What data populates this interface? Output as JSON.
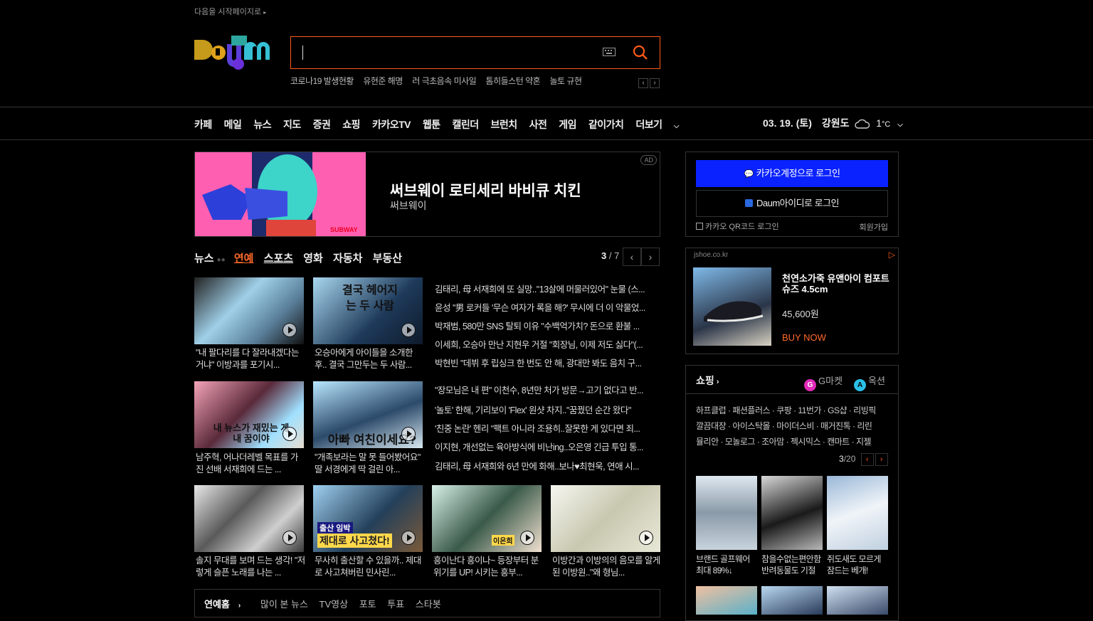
{
  "top": {
    "start_page": "다음을 시작페이지로"
  },
  "logo": {
    "alt": "Daum"
  },
  "search": {
    "value": ""
  },
  "trends": [
    "코로나19 발생현황",
    "유현준 해명",
    "러 극초음속 미사일",
    "톰히들스턴 약혼",
    "놀토 규현"
  ],
  "gnb": {
    "items": [
      "카페",
      "메일",
      "뉴스",
      "지도",
      "증권",
      "쇼핑",
      "카카오TV",
      "웹툰",
      "캘린더",
      "브런치",
      "사전",
      "게임",
      "같이가치",
      "더보기"
    ],
    "date": "03. 19. (토)",
    "region": "강원도",
    "temp": "1",
    "temp_unit": "°C"
  },
  "ad": {
    "title": "써브웨이 로티세리 바비큐 치킨",
    "subtitle": "써브웨이",
    "badge": "AD"
  },
  "news_tabs": {
    "items": [
      "뉴스",
      "연예",
      "스포츠",
      "영화",
      "자동차",
      "부동산"
    ],
    "active": "연예",
    "page_current": "3",
    "page_total": "7"
  },
  "news": {
    "cards": [
      {
        "caption": "\"내 팔다리를 다 잘라내겠다는 거냐\" 이방과를 포기시..."
      },
      {
        "caption": "오승아에게 아이들을 소개한 후.. 결국 그만두는 두 사람..."
      },
      {
        "caption": "남주혁, 어나더레벨 목표를 가진 선배 서재희에 드는 ..."
      },
      {
        "caption": "\"개족보라는 말 못 들어봤어요\" 딸 서경에게 딱 걸린 아..."
      },
      {
        "caption": "솔지 무대를 보며 드는 생각! \"저렇게 슬픈 노래를 나는 ..."
      },
      {
        "caption": "무사히 출산할 수 있을까.. 제대로 사고쳐버린 민사린..."
      },
      {
        "caption": "흥이난다 흥이나~ 등장부터 분위기를 UP! 시키는 흥부..."
      },
      {
        "caption": "이방간과 이방의의 음모를 알게 된 이방원..\"왜 형님..."
      }
    ],
    "thumb_texts": [
      "결국 헤어지는 두 사람",
      "내 뉴스가 재밌는 게 내 꿈이야",
      "아빠 여친이세요?",
      "출산 임박",
      "제대로 사고쳤다!",
      "이은희"
    ],
    "headlines": [
      "김태리, 母 서재희에 또 실망..\"13살에 머물러있어\" 눈물 (스...",
      "윤성 \"男 로커들 '무슨 여자가 록을 해?' 무시에 더 이 악물었...",
      "박재범, 580만 SNS 탈퇴 이유 \"수백억가치? 돈으로 환불 ...",
      "이세희, 오승아 만난 지현우 거절 \"회장님, 이제 저도 싫다\"(...",
      "박현빈 \"데뷔 후 립싱크 한 번도 안 해, 광대만 봐도 음치 구...",
      "\"장모님은 내 편\" 이천수, 8년만 처가 방문→고기 없다고 반...",
      "'놀토' 한해, 기리보이 'Flex' 원샷 차지..\"꿈꿨던 순간 왔다\"",
      "'친중 논란' 헨리 \"팩트 아니라 조용히..잘못한 게 있다면 죄...",
      "이지현, 개선없는 육아방식에 비난ing..오은영 긴급 투입 통...",
      "김태리, 母 서재희와 6년 만에 화해..보나♥최현욱, 연애 시..."
    ]
  },
  "bottom_tabs": [
    "연예홈",
    "많이 본 뉴스",
    "TV영상",
    "포토",
    "투표",
    "스타봇"
  ],
  "login": {
    "kakao_label": "카카오계정으로 로그인",
    "daum_label": "Daum아이디로 로그인",
    "qr_label": "카카오 QR코드 로그인",
    "join_label": "회원가입"
  },
  "ad2": {
    "source": "jshoe.co.kr",
    "title": "천연소가죽 유앤아이 컴포트슈즈 4.5cm",
    "price": "45,600원",
    "cta": "BUY NOW"
  },
  "shopping": {
    "title": "쇼핑",
    "gmarket": "G마켓",
    "auction": "옥션",
    "links_row1": "하프클럽 · 패션플러스 · 쿠팡 · 11번가 · GS샵 · 리빙픽",
    "links_row2": "깔끔대장 · 아이스탁몰 · 마이더스비 · 매거진톡 · 리린",
    "links_row3": "뮬리안 · 모놀로그 · 조아맘 · 젝시믹스 · 캔마트 · 지젤",
    "page_current": "3",
    "page_total": "/20",
    "products": [
      {
        "caption": "브랜드 골프웨어 최대 89%↓"
      },
      {
        "caption": "참을수없는편안함 반려동물도 기절"
      },
      {
        "caption": "쥐도새도 모르게 잠드는 베개!"
      }
    ]
  },
  "colors": {
    "accent": "#ff5a16",
    "kakao_blue": "#0a22ff",
    "background": "#000000"
  }
}
